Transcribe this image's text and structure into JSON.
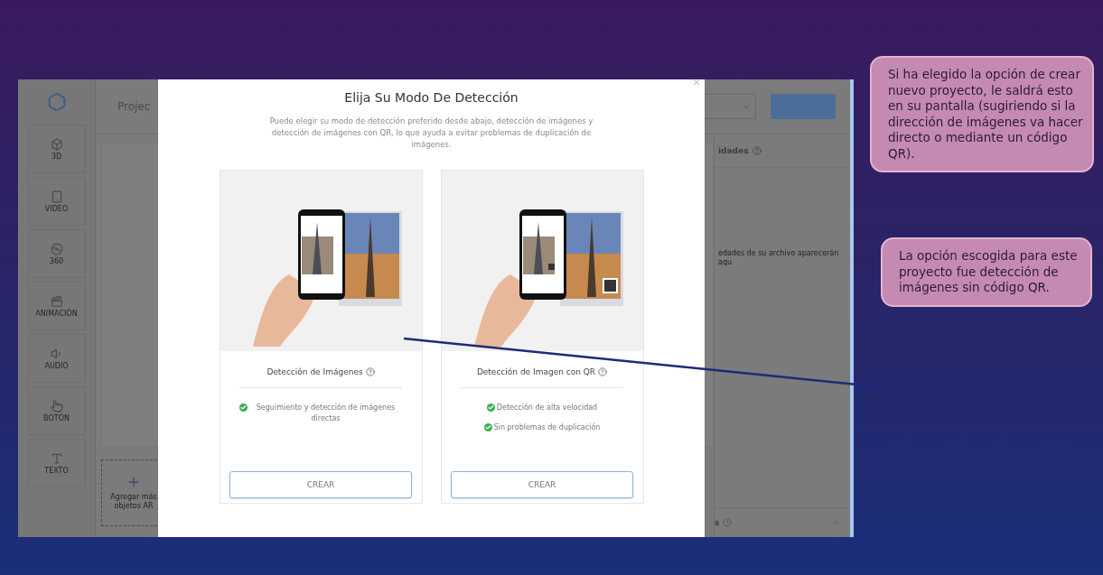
{
  "slide": {
    "callouts": [
      {
        "text": "Si ha elegido la opción de crear nuevo proyecto, le saldrá esto en su pantalla (sugiriendo si la dirección de imágenes va hacer directo o mediante un código QR)."
      },
      {
        "text": "La opción escogida para este proyecto fue detección de imágenes sin código QR."
      }
    ]
  },
  "app": {
    "sidebar": {
      "items": [
        {
          "label": "3D"
        },
        {
          "label": "VIDEO"
        },
        {
          "label": "360"
        },
        {
          "label": "ANIMACIÓN"
        },
        {
          "label": "AUDIO"
        },
        {
          "label": "BOTÓN"
        },
        {
          "label": "TEXTO"
        }
      ]
    },
    "header": {
      "project_title": "Projec"
    },
    "add_objects": {
      "label": "Agregar más objetos AR"
    },
    "right_panel": {
      "section_title": "idades",
      "empty_hint": "edades de su archivo aparecerán aqu",
      "bottom_section": "s"
    }
  },
  "modal": {
    "close": "×",
    "title": "Elija Su Modo De Detección",
    "description": "Puede elegir su modo de detección preferido desde abajo, detección de imágenes y detección de imágenes con QR, lo que ayuda a evitar problemas de duplicación de imágenes.",
    "cards": [
      {
        "kind": "plain",
        "title": "Detección de Imágenes",
        "features": [
          "Seguimiento y detección de imágenes directas"
        ],
        "button": "CREAR"
      },
      {
        "kind": "qr",
        "title": "Detección de Imagen con QR",
        "features": [
          "Detección de alta velocidad",
          "Sin problemas de duplicación"
        ],
        "button": "CREAR"
      }
    ]
  }
}
